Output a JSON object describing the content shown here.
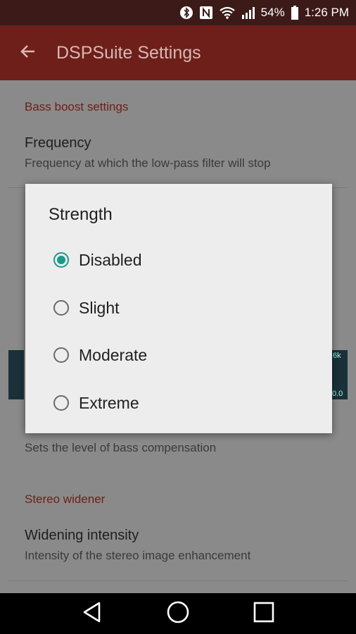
{
  "status_bar": {
    "battery": "54%",
    "time": "1:26 PM",
    "icons": [
      "bluetooth-icon",
      "nfc-icon",
      "wifi-icon",
      "signal-icon",
      "battery-icon"
    ]
  },
  "app_bar": {
    "title": "DSPSuite Settings",
    "back_icon": "arrow-back-icon"
  },
  "content": {
    "section1": "Bass boost settings",
    "frequency_title": "Frequency",
    "frequency_sub": "Frequency at which the low-pass filter will stop",
    "strength_sub": "Sets the level of bass compensation",
    "section2": "Stereo widener",
    "widening_title": "Widening intensity",
    "widening_sub": "Intensity of the stereo image enhancement",
    "eq_right_label": "6k",
    "eq_right_value": "0.0"
  },
  "dialog": {
    "title": "Strength",
    "options": [
      {
        "label": "Disabled",
        "checked": true
      },
      {
        "label": "Slight",
        "checked": false
      },
      {
        "label": "Moderate",
        "checked": false
      },
      {
        "label": "Extreme",
        "checked": false
      }
    ]
  },
  "nav_bar": {
    "icons": [
      "back-triangle-icon",
      "home-circle-icon",
      "recents-square-icon"
    ]
  },
  "colors": {
    "accent": "#1a9a8a",
    "appbar": "#6e1f19",
    "section_header": "#6d1f18"
  }
}
